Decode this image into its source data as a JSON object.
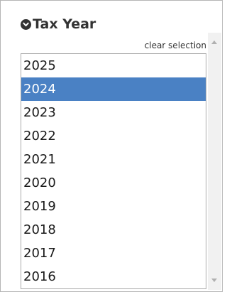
{
  "section": {
    "title": "Tax Year",
    "toggle_icon": "chevron-down-circle-icon"
  },
  "clear_selection": "clear selection",
  "years": {
    "options": [
      "2025",
      "2024",
      "2023",
      "2022",
      "2021",
      "2020",
      "2019",
      "2018",
      "2017",
      "2016"
    ],
    "selected": "2024"
  },
  "colors": {
    "selected_bg": "#4a81c4",
    "selected_text": "#ffffff",
    "header_text": "#333333"
  }
}
